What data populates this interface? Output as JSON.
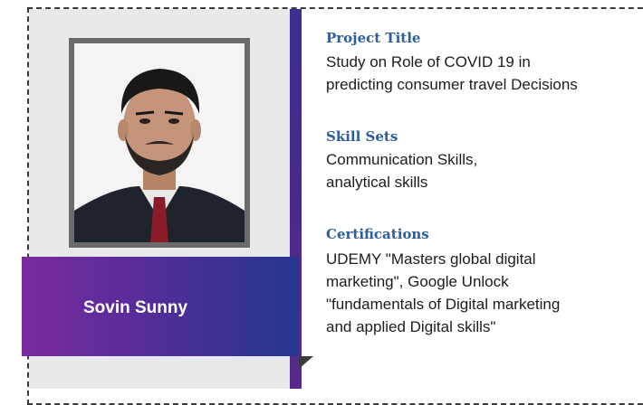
{
  "profile": {
    "name": "Sovin Sunny"
  },
  "sections": {
    "project": {
      "heading": "Project Title",
      "line1": "Study on Role of COVID 19 in",
      "line2": "predicting consumer travel Decisions"
    },
    "skills": {
      "heading": "Skill Sets",
      "line1": "Communication Skills,",
      "line2": "analytical skills"
    },
    "certifications": {
      "heading": "Certifications",
      "line1": "UDEMY \"Masters global digital",
      "line2": "marketing\", Google Unlock",
      "line3": "\"fundamentals of Digital marketing",
      "line4": "and applied Digital skills\""
    }
  },
  "colors": {
    "heading": "#2d5d9c",
    "ribbon_start": "#7a2aa0",
    "ribbon_end": "#25388f",
    "panel": "#e8e9ea"
  }
}
